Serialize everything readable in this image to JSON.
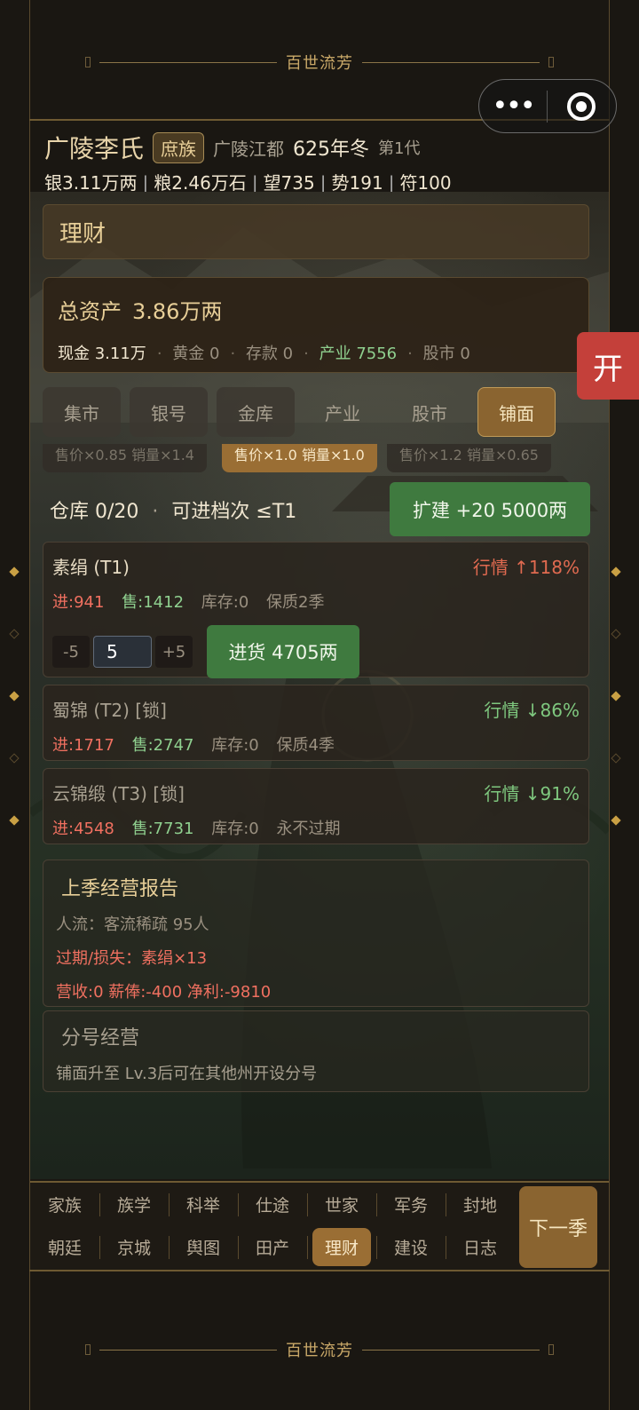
{
  "app": {
    "banner_title": "百世流芳"
  },
  "capsule": {
    "more_icon": "more-dots-icon",
    "close_icon": "target-icon"
  },
  "header": {
    "clan": "广陵李氏",
    "rank": "庶族",
    "location": "广陵江都",
    "year": "625年冬",
    "generation": "第1代",
    "stats": [
      "银3.11万两",
      "粮2.46万石",
      "望735",
      "势191",
      "符100"
    ]
  },
  "page": {
    "title": "理财"
  },
  "assets": {
    "total_label": "总资产",
    "total_value": "3.86万两",
    "cash": "现金 3.11万",
    "gold": "黄金 0",
    "deposit": "存款 0",
    "industry": "产业 7556",
    "stock": "股市 0"
  },
  "tabs": [
    {
      "label": "集市"
    },
    {
      "label": "银号"
    },
    {
      "label": "金库"
    },
    {
      "label": "产业"
    },
    {
      "label": "股市"
    },
    {
      "label": "铺面"
    }
  ],
  "price_modes": [
    "售价×0.85 销量×1.4",
    "售价×1.0 销量×1.0",
    "售价×1.2 销量×0.65"
  ],
  "warehouse": {
    "capacity": "仓库 0/20",
    "tier": "可进档次 ≤T1",
    "expand_button": "扩建 +20 5000两"
  },
  "goods": [
    {
      "name": "素绢 (T1)",
      "trend": "行情 ↑118%",
      "buy": "进:941",
      "sell": "售:1412",
      "stock": "库存:0",
      "shelf": "保质2季",
      "qty": "5",
      "minus": "-5",
      "plus": "+5",
      "buy_button": "进货 4705两"
    },
    {
      "name": "蜀锦 (T2) [锁]",
      "trend": "行情 ↓86%",
      "buy": "进:1717",
      "sell": "售:2747",
      "stock": "库存:0",
      "shelf": "保质4季"
    },
    {
      "name": "云锦缎 (T3) [锁]",
      "trend": "行情 ↓91%",
      "buy": "进:4548",
      "sell": "售:7731",
      "stock": "库存:0",
      "shelf": "永不过期"
    }
  ],
  "report": {
    "title": "上季经营报告",
    "traffic": "人流：客流稀疏 95人",
    "loss": "过期/损失：素绢×13",
    "summary": "营收:0 薪俸:-400 净利:-9810"
  },
  "branch": {
    "title": "分号经营",
    "desc": "铺面升至 Lv.3后可在其他州开设分号"
  },
  "open_button": "开",
  "nav": {
    "row1": [
      "家族",
      "族学",
      "科举",
      "仕途",
      "世家",
      "军务",
      "封地"
    ],
    "row2": [
      "朝廷",
      "京城",
      "舆图",
      "田产",
      "理财",
      "建设",
      "日志"
    ],
    "next_button": "下一季"
  },
  "colors": {
    "accent": "#8a6430",
    "buy_green": "#3f7a3f",
    "open_red": "#c4403a"
  }
}
